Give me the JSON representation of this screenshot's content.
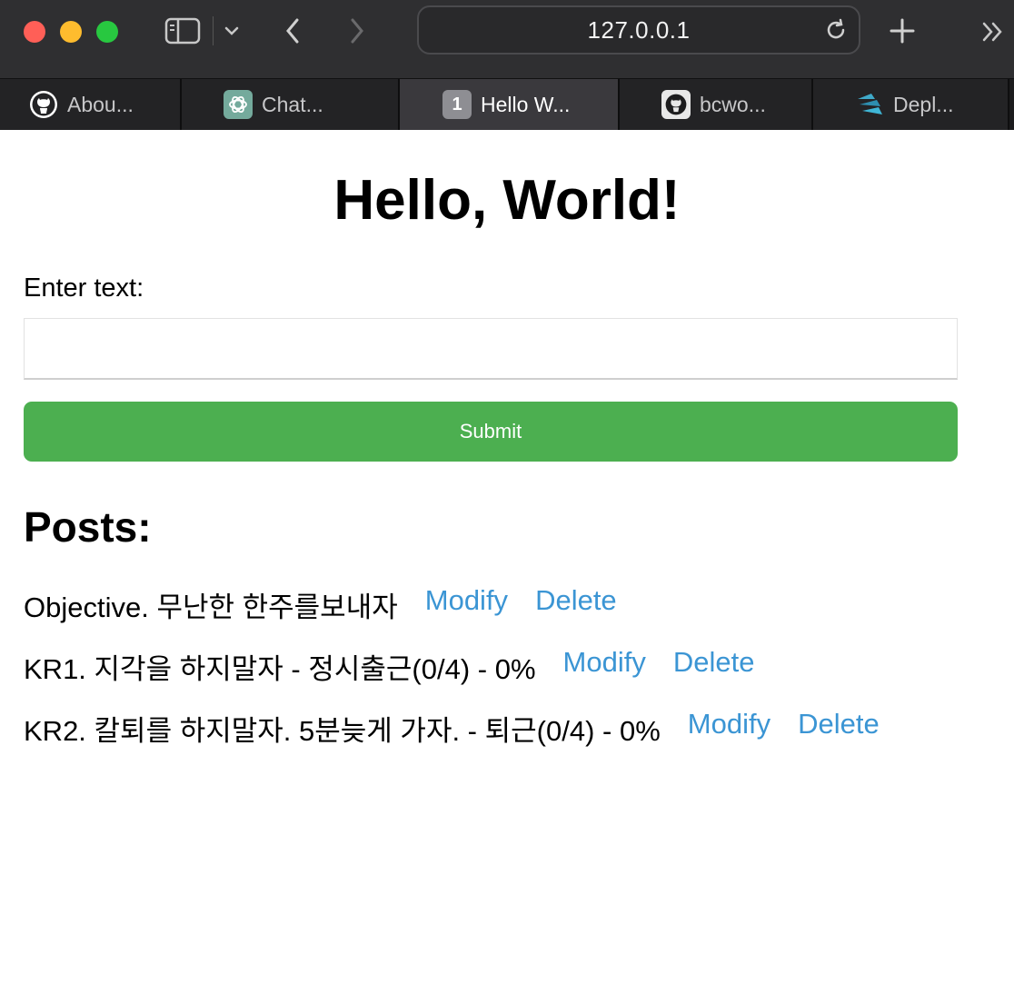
{
  "browser": {
    "url": "127.0.0.1",
    "colors": {
      "close": "#ff5f57",
      "minimize": "#febc2e",
      "maximize": "#28c840"
    },
    "icons": [
      "sidebar-icon",
      "chevron-down-icon",
      "back-icon",
      "forward-icon",
      "reload-icon",
      "plus-icon",
      "double-chevron-icon"
    ],
    "tabs": [
      {
        "label": "Abou...",
        "icon": "github-icon"
      },
      {
        "label": "Chat...",
        "icon": "chatgpt-icon"
      },
      {
        "label": "Hello W...",
        "icon": "number-badge",
        "badge": "1",
        "active": true
      },
      {
        "label": "bcwo...",
        "icon": "github-icon"
      },
      {
        "label": "Depl...",
        "icon": "deploy-icon"
      }
    ]
  },
  "page": {
    "title": "Hello, World!",
    "input_label": "Enter text:",
    "input_value": "",
    "submit_label": "Submit",
    "posts_heading": "Posts:",
    "posts": [
      {
        "text": "Objective. 무난한 한주를보내자",
        "modify": "Modify",
        "delete": "Delete"
      },
      {
        "text": "KR1. 지각을 하지말자 - 정시출근(0/4) - 0%",
        "modify": "Modify",
        "delete": "Delete"
      },
      {
        "text": "KR2. 칼퇴를 하지말자. 5분늦게 가자. - 퇴근(0/4) - 0%",
        "modify": "Modify",
        "delete": "Delete"
      }
    ],
    "colors": {
      "submit": "#4caf50",
      "link": "#3b95d4"
    }
  }
}
